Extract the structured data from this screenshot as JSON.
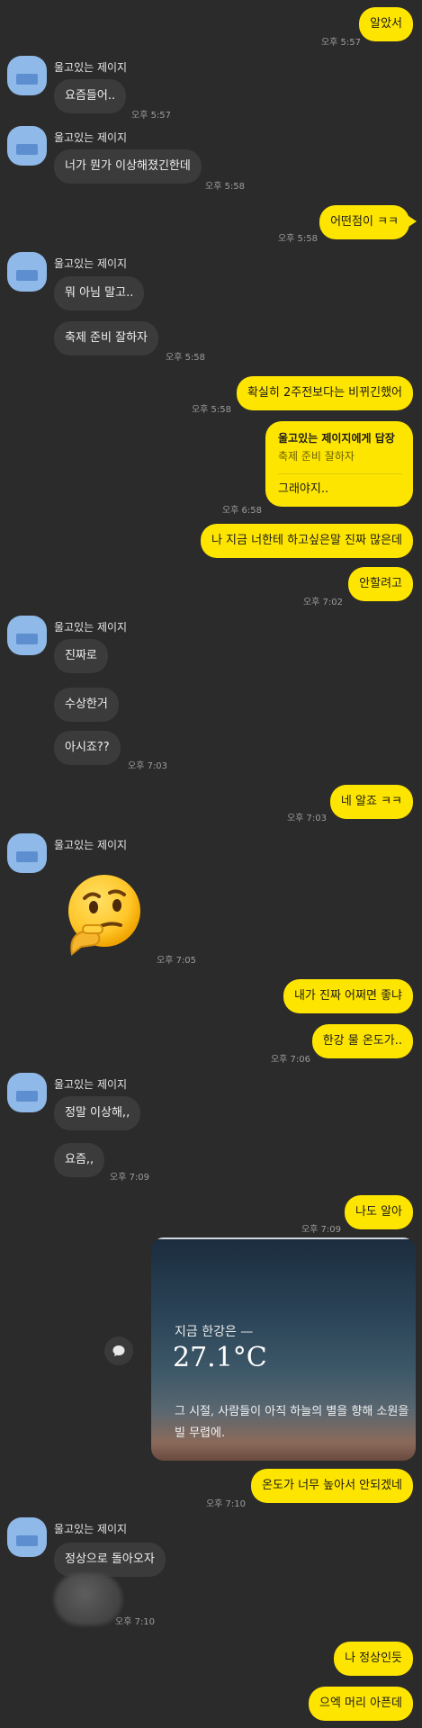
{
  "sender_name": "울고있는 제이지",
  "messages": {
    "m1": {
      "text": "알았서",
      "time": "오후 5:57"
    },
    "m2": {
      "text": "요즘들어..",
      "time": "오후 5:57"
    },
    "m3": {
      "text": "너가 뭔가 이상해졌긴한데",
      "time": "오후 5:58"
    },
    "m4": {
      "text": "어떤점이 ㅋㅋ",
      "time": "오후 5:58"
    },
    "m5": {
      "text": "뭐 아님 말고.."
    },
    "m6": {
      "text": "축제 준비 잘하자",
      "time": "오후 5:58"
    },
    "m7": {
      "text": "확실히 2주전보다는 비뀌긴했어",
      "time": "오후 5:58"
    },
    "m8": {
      "reply_title": "울고있는 제이지에게 답장",
      "reply_quote": "축제 준비 잘하자",
      "text": "그래야지..",
      "time": "오후 6:58"
    },
    "m9": {
      "text": "나 지금 너한테 하고싶은말 진짜 많은데"
    },
    "m10": {
      "text": "안할려고",
      "time": "오후 7:02"
    },
    "m11": {
      "text": "진짜로"
    },
    "m12": {
      "text": "수상한거"
    },
    "m13": {
      "text": "아시죠??",
      "time": "오후 7:03"
    },
    "m14": {
      "text": "네 알죠 ㅋㅋ",
      "time": "오후 7:03"
    },
    "m15": {
      "emoji": "🤔",
      "time": "오후 7:05"
    },
    "m16": {
      "text": "내가 진짜 어쩌면 좋냐"
    },
    "m17": {
      "text": "한강 물 온도가..",
      "time": "오후 7:06"
    },
    "m18": {
      "text": "정말 이상해,,"
    },
    "m19": {
      "text": "요즘,,",
      "time": "오후 7:09"
    },
    "m20": {
      "text": "나도 알아",
      "time": "오후 7:09"
    },
    "m21": {
      "text": "온도가 너무 높아서 안되겠네",
      "time": "오후 7:10"
    },
    "m22": {
      "text": "정상으로 돌아오자",
      "time": "오후 7:10"
    },
    "m23": {
      "text": "나 정상인듯"
    },
    "m24": {
      "text": "으엑 머리 아픈데"
    }
  },
  "weather_card": {
    "label": "지금 한강은  —",
    "temperature": "27.1°C",
    "caption": "그 시절, 사람들이 아직 하늘의 별을 향해 소원을 빌 무렵에."
  },
  "icons": {
    "avatar": "profile-avatar-icon",
    "share": "chat-bubble-icon"
  },
  "colors": {
    "background": "#2b2b2b",
    "my_bubble": "#fee500",
    "their_bubble": "#3b3b3b"
  }
}
